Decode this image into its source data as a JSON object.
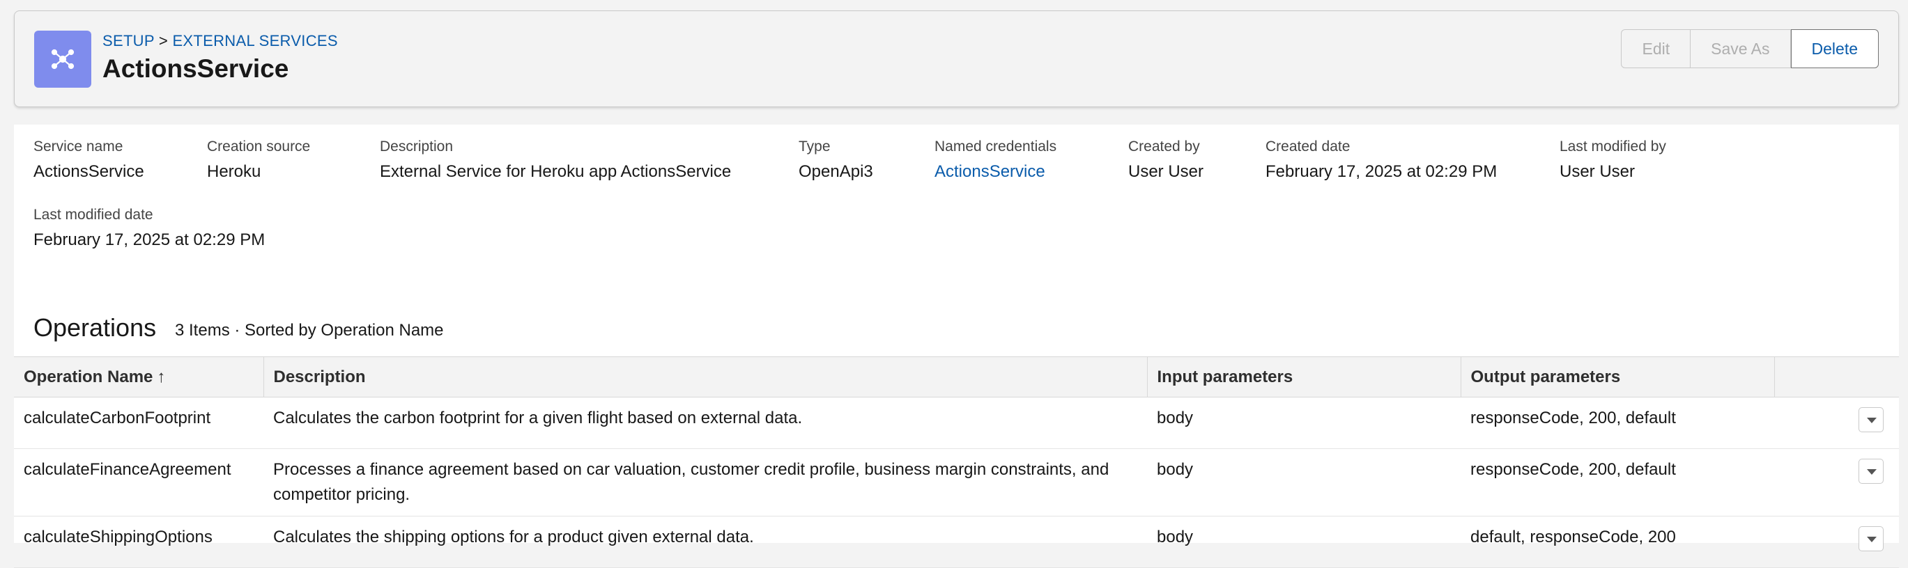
{
  "header": {
    "breadcrumb_setup": "SETUP",
    "breadcrumb_sep": ">",
    "breadcrumb_services": "EXTERNAL SERVICES",
    "title": "ActionsService",
    "icon": "external-service-icon",
    "icon_color": "#7f8ced",
    "buttons": {
      "edit": "Edit",
      "save_as": "Save As",
      "delete": "Delete"
    }
  },
  "fields": {
    "service_name": {
      "label": "Service name",
      "value": "ActionsService"
    },
    "creation_source": {
      "label": "Creation source",
      "value": "Heroku"
    },
    "description": {
      "label": "Description",
      "value": "External Service for Heroku app ActionsService"
    },
    "type": {
      "label": "Type",
      "value": "OpenApi3"
    },
    "named_credentials": {
      "label": "Named credentials",
      "value": "ActionsService"
    },
    "created_by": {
      "label": "Created by",
      "value": "User User"
    },
    "created_date": {
      "label": "Created date",
      "value": "February 17, 2025 at 02:29 PM"
    },
    "last_modified_by": {
      "label": "Last modified by",
      "value": "User User"
    },
    "last_modified_date": {
      "label": "Last modified date",
      "value": "February 17, 2025 at 02:29 PM"
    }
  },
  "operations": {
    "title": "Operations",
    "meta": "3 Items · Sorted by Operation Name",
    "columns": [
      "Operation Name",
      "Description",
      "Input parameters",
      "Output parameters"
    ],
    "sort_indicator": "↑",
    "rows": [
      {
        "name": "calculateCarbonFootprint",
        "description": "Calculates the carbon footprint for a given flight based on external data.",
        "input": "body",
        "output": "responseCode, 200, default"
      },
      {
        "name": "calculateFinanceAgreement",
        "description": "Processes a finance agreement based on car valuation, customer credit profile, business margin constraints, and competitor pricing.",
        "input": "body",
        "output": "responseCode, 200, default"
      },
      {
        "name": "calculateShippingOptions",
        "description": "Calculates the shipping options for a product given external data.",
        "input": "body",
        "output": "default, responseCode, 200"
      }
    ]
  },
  "colors": {
    "link": "#0b5cab",
    "header_bg": "#f3f3f3",
    "accent_icon": "#7f8ced"
  }
}
